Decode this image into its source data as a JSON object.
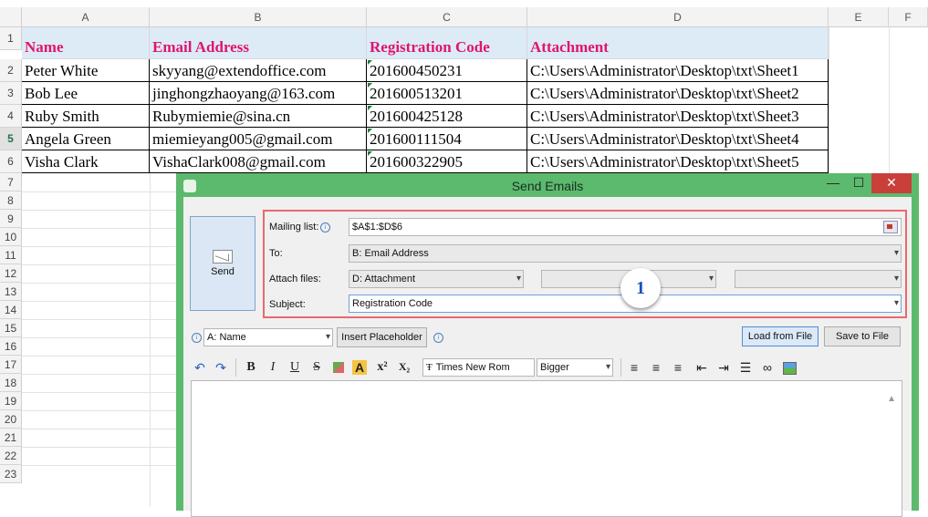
{
  "spreadsheet": {
    "columns": [
      "A",
      "B",
      "C",
      "D",
      "E",
      "F"
    ],
    "rows": [
      "1",
      "2",
      "3",
      "4",
      "5",
      "6",
      "7",
      "8",
      "9",
      "10",
      "11",
      "12",
      "13",
      "14",
      "15",
      "16",
      "17",
      "18",
      "19",
      "20",
      "21",
      "22",
      "23"
    ],
    "header": [
      "Name",
      "Email Address",
      "Registration Code",
      "Attachment"
    ],
    "data": [
      [
        "Peter White",
        "skyyang@extendoffice.com",
        "201600450231",
        "C:\\Users\\Administrator\\Desktop\\txt\\Sheet1"
      ],
      [
        "Bob Lee",
        "jinghongzhaoyang@163.com",
        "201600513201",
        "C:\\Users\\Administrator\\Desktop\\txt\\Sheet2"
      ],
      [
        "Ruby Smith",
        "Rubymiemie@sina.cn",
        "201600425128",
        "C:\\Users\\Administrator\\Desktop\\txt\\Sheet3"
      ],
      [
        "Angela Green",
        "miemieyang005@gmail.com",
        "201600111504",
        "C:\\Users\\Administrator\\Desktop\\txt\\Sheet4"
      ],
      [
        "Visha Clark",
        "VishaClark008@gmail.com",
        "201600322905",
        "C:\\Users\\Administrator\\Desktop\\txt\\Sheet5"
      ]
    ],
    "header_color": "#e0146f",
    "header_fill": "#ddebf7"
  },
  "dialog": {
    "title": "Send Emails",
    "send_label": "Send",
    "fields": {
      "mailing_list_label": "Mailing list:",
      "mailing_list_value": "$A$1:$D$6",
      "to_label": "To:",
      "to_value": "B: Email Address",
      "attach_label": "Attach files:",
      "attach_value": "D: Attachment",
      "subject_label": "Subject:",
      "subject_value": "Registration Code"
    },
    "badge": "1",
    "placeholder_select": "A: Name",
    "insert_placeholder": "Insert Placeholder",
    "load_from_file": "Load from File",
    "save_to_file": "Save to File",
    "toolbar": {
      "font": "Times New Rom",
      "size": "Bigger",
      "bold": "B",
      "italic": "I",
      "underline": "U",
      "strike": "S",
      "fontcolor": "A",
      "superscript": "x²",
      "subscript": "X₂",
      "font_glyph": "Ŧ"
    },
    "window_controls": {
      "minimize": "—",
      "maximize": "☐",
      "close": "✕"
    },
    "info_glyph": "i",
    "caret_glyph": "▾",
    "dialog_color": "#5cba6e",
    "focus_color": "#e8696e"
  }
}
